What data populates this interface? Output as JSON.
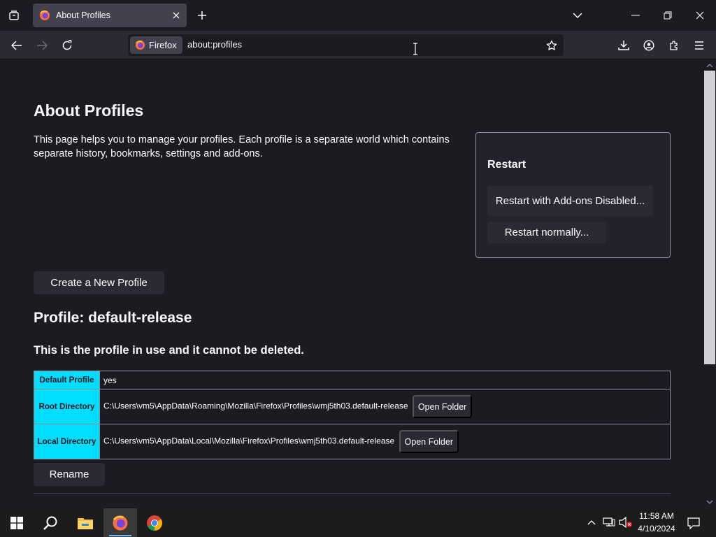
{
  "browser": {
    "tab_title": "About Profiles",
    "identity_label": "Firefox",
    "url": "about:profiles"
  },
  "page": {
    "title": "About Profiles",
    "intro": "This page helps you to manage your profiles. Each profile is a separate world which contains separate history, bookmarks, settings and add-ons.",
    "restart": {
      "title": "Restart",
      "addons_button": "Restart with Add-ons Disabled...",
      "normal_button": "Restart normally..."
    },
    "create_button": "Create a New Profile",
    "profile": {
      "heading": "Profile: default-release",
      "note": "This is the profile in use and it cannot be deleted.",
      "rows": [
        {
          "label": "Default Profile",
          "value": "yes"
        },
        {
          "label": "Root Directory",
          "value": "C:\\Users\\vm5\\AppData\\Roaming\\Mozilla\\Firefox\\Profiles\\wmj5th03.default-release",
          "button": "Open Folder"
        },
        {
          "label": "Local Directory",
          "value": "C:\\Users\\vm5\\AppData\\Local\\Mozilla\\Firefox\\Profiles\\wmj5th03.default-release",
          "button": "Open Folder"
        }
      ],
      "rename_button": "Rename"
    }
  },
  "taskbar": {
    "time": "11:58 AM",
    "date": "4/10/2024"
  },
  "colors": {
    "accent_cyan": "#00ddff",
    "page_bg": "#1c1b22",
    "toolbar_bg": "#2b2a33",
    "taskbar_bg": "#1c1c1c"
  },
  "icons": [
    "tab-list-icon",
    "firefox-logo-icon",
    "close-icon",
    "new-tab-icon",
    "chevron-down-icon",
    "minimize-icon",
    "restore-icon",
    "back-icon",
    "forward-icon",
    "reload-icon",
    "bookmark-star-icon",
    "downloads-icon",
    "account-icon",
    "extensions-icon",
    "menu-icon",
    "windows-start-icon",
    "search-icon",
    "file-explorer-icon",
    "chrome-icon",
    "tray-chevron-icon",
    "network-icon",
    "volume-muted-icon",
    "notifications-icon"
  ]
}
